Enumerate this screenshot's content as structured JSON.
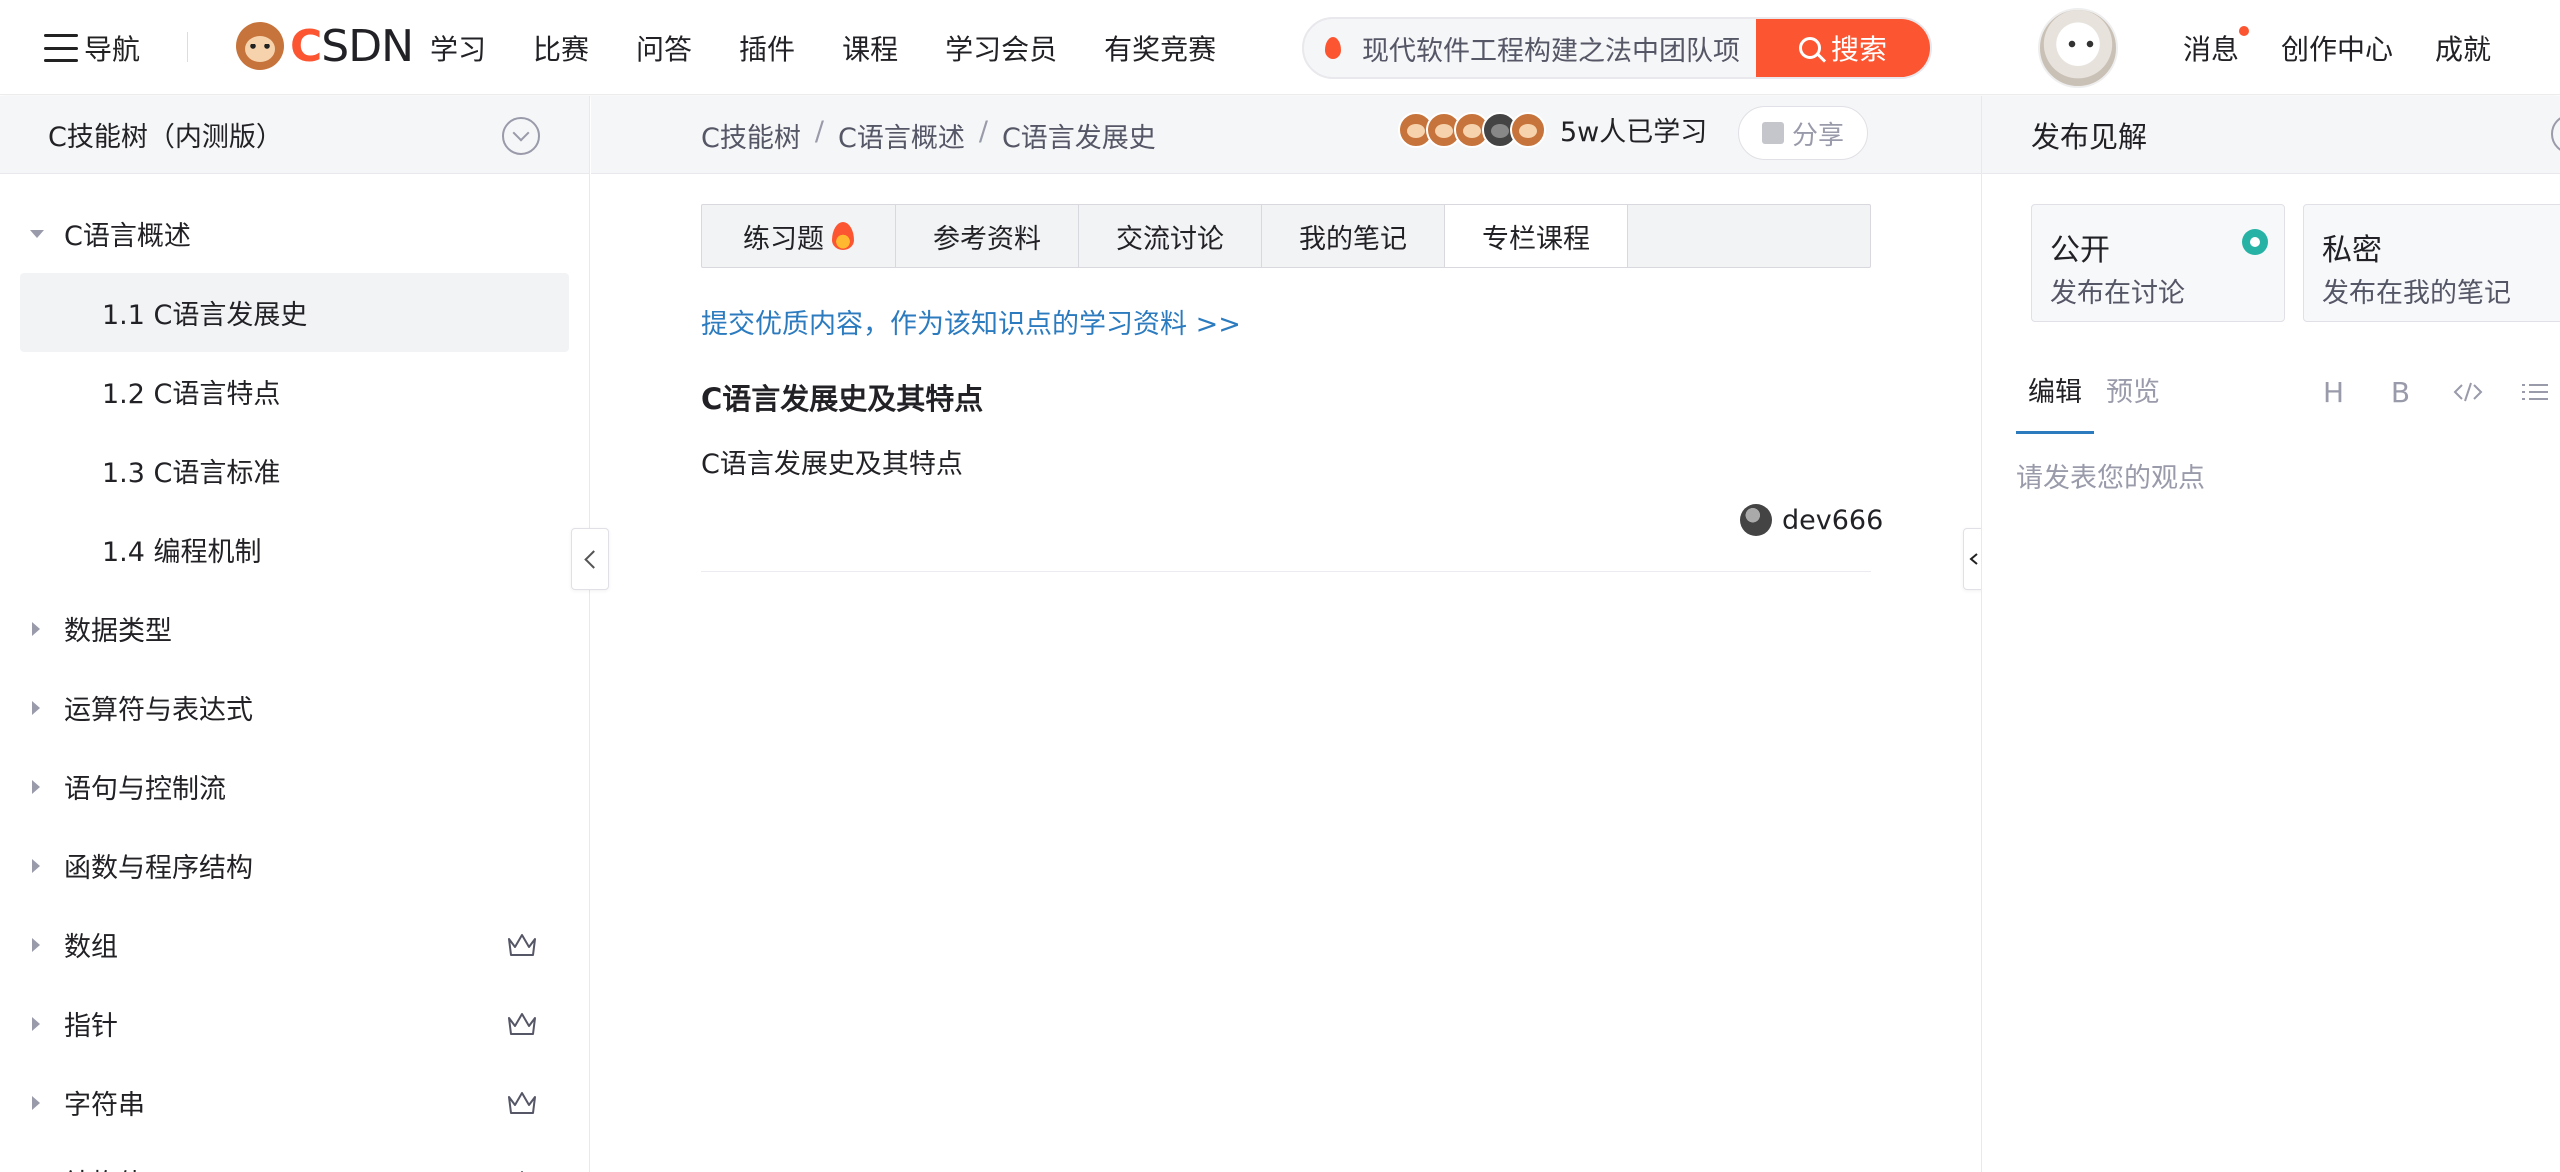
{
  "topbar": {
    "nav_label": "导航",
    "logo_text_c": "C",
    "logo_text_rest": "SDN",
    "nav_links": [
      "学习",
      "比赛",
      "问答",
      "插件",
      "课程",
      "学习会员",
      "有奖竞赛"
    ],
    "search_value": "现代软件工程构建之法中团队项",
    "search_button": "搜索",
    "right_links": [
      "消息",
      "创作中心",
      "成就"
    ],
    "brand_color": "#fc5531"
  },
  "sidebar": {
    "title": "C技能树（内测版）",
    "items": [
      {
        "label": "C语言概述",
        "level": "root",
        "expanded": true
      },
      {
        "label": "1.1 C语言发展史",
        "level": "sub",
        "active": true
      },
      {
        "label": "1.2 C语言特点",
        "level": "sub"
      },
      {
        "label": "1.3 C语言标准",
        "level": "sub"
      },
      {
        "label": "1.4 编程机制",
        "level": "sub"
      },
      {
        "label": "数据类型",
        "level": "root"
      },
      {
        "label": "运算符与表达式",
        "level": "root"
      },
      {
        "label": "语句与控制流",
        "level": "root"
      },
      {
        "label": "函数与程序结构",
        "level": "root"
      },
      {
        "label": "数组",
        "level": "root",
        "premium": true
      },
      {
        "label": "指针",
        "level": "root",
        "premium": true
      },
      {
        "label": "字符串",
        "level": "root",
        "premium": true
      },
      {
        "label": "结构体",
        "level": "root",
        "premium": true
      }
    ]
  },
  "main": {
    "breadcrumb": [
      "C技能树",
      "C语言概述",
      "C语言发展史"
    ],
    "breadcrumb_sep": "/",
    "learners_text": "5w人已学习",
    "share_label": "分享",
    "tabs": [
      "练习题",
      "参考资料",
      "交流讨论",
      "我的笔记",
      "专栏课程"
    ],
    "active_tab": "专栏课程",
    "submit_link": "提交优质内容，作为该知识点的学习资料 >>",
    "article_title": "C语言发展史及其特点",
    "article_summary": "C语言发展史及其特点",
    "author": "dev666"
  },
  "right_panel": {
    "title": "发布见解",
    "visibility": [
      {
        "title": "公开",
        "desc": "发布在讨论",
        "selected": true
      },
      {
        "title": "私密",
        "desc": "发布在我的笔记",
        "selected": false
      }
    ],
    "editor_tabs": [
      "编辑",
      "预览"
    ],
    "tools": [
      "H",
      "B"
    ],
    "editor_placeholder": "请发表您的观点",
    "accent_color": "#26b3a5"
  }
}
